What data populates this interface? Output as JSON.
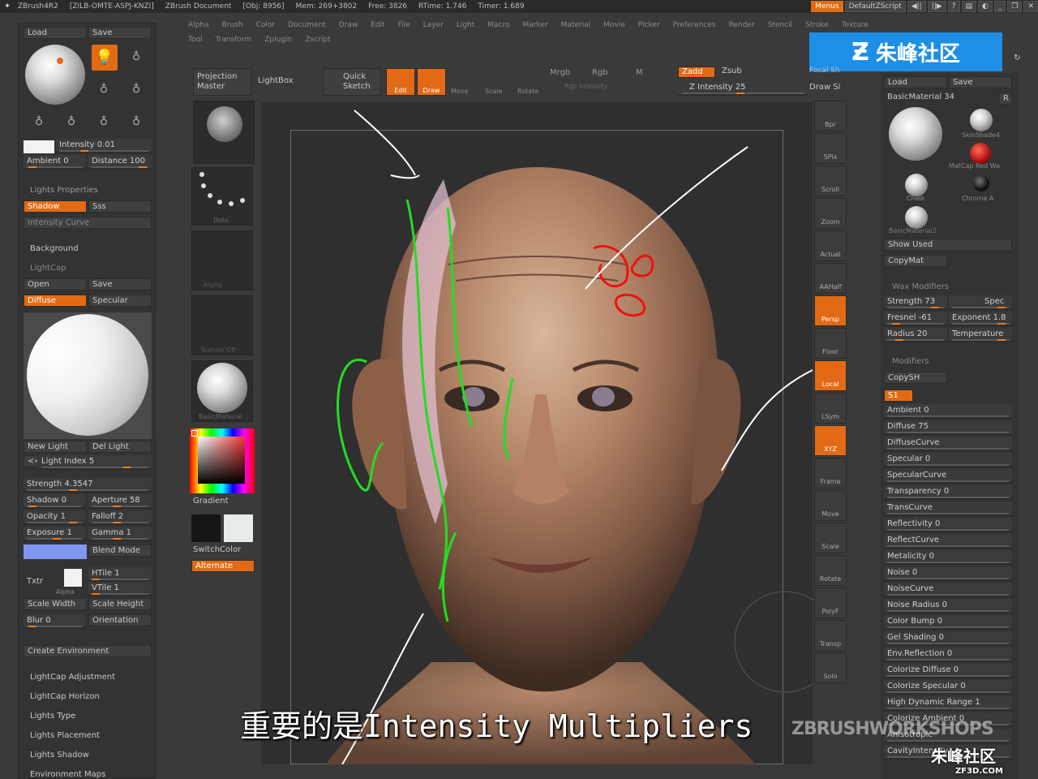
{
  "titlebar": {
    "app": "ZBrush4R2",
    "license": "[ZILB-OMTE-ASPJ-KNZI]",
    "doc": "ZBrush Document",
    "obj": "[Obj: 8956]",
    "mem": "Mem: 269+3802",
    "free": "Free: 3826",
    "rtime": "RTime: 1.746",
    "timer": "Timer: 1.689",
    "menus_btn": "Menus",
    "script_btn": "DefaultZScript"
  },
  "menubar": {
    "row1": [
      "Alpha",
      "Brush",
      "Color",
      "Document",
      "Draw",
      "Edit",
      "File",
      "Layer",
      "Light",
      "Macro",
      "Marker",
      "Material",
      "Movie",
      "Picker",
      "Preferences",
      "Render",
      "Stencil",
      "Stroke",
      "Texture"
    ],
    "row2": [
      "Tool",
      "Transform",
      "Zplugin",
      "Zscript"
    ]
  },
  "watermark": {
    "brand": "朱峰社区",
    "brand_small": "ZF3D.COM",
    "bottom_text": "ZBRUSHWORKSHOPS"
  },
  "toolbar": {
    "projection_master": "Projection Master",
    "lightbox": "LightBox",
    "quick_sketch": "Quick Sketch",
    "edit": "Edit",
    "draw": "Draw",
    "move": "Move",
    "scale": "Scale",
    "rotate": "Rotate",
    "mrgb": "Mrgb",
    "rgb": "Rgb",
    "m": "M",
    "rgb_intensity": "Rgb Intensity",
    "zadd": "Zadd",
    "zsub": "Zsub",
    "z_intensity": "Z Intensity 25",
    "focal": "Focal Sh",
    "draw_size": "Draw Si"
  },
  "left_panel": {
    "load": "Load",
    "save": "Save",
    "intensity": "Intensity 0.01",
    "ambient": "Ambient 0",
    "distance": "Distance 100",
    "lights_properties": "Lights Properties",
    "shadow": "Shadow",
    "sss": "Sss",
    "intensity_curve": "Intensity Curve",
    "background": "Background",
    "lightcap": "LightCap",
    "open": "Open",
    "save2": "Save",
    "diffuse": "Diffuse",
    "specular": "Specular",
    "new_light": "New Light",
    "del_light": "Del Light",
    "light_index": "Light Index 5",
    "strength": "Strength 4.3547",
    "shadow_val": "Shadow 0",
    "aperture": "Aperture 58",
    "opacity": "Opacity 1",
    "falloff": "Falloff 2",
    "exposure": "Exposure 1",
    "gamma": "Gamma 1",
    "blend_mode": "Blend Mode",
    "txtr": "Txtr",
    "alpha": "Alpha",
    "htile": "HTile 1",
    "vtile": "VTile 1",
    "scale_width": "Scale Width",
    "scale_height": "Scale Height",
    "blur": "Blur 0",
    "orientation": "Orientation",
    "create_env": "Create Environment",
    "lightcap_adj": "LightCap Adjustment",
    "lightcap_horizon": "LightCap Horizon",
    "lights_type": "Lights Type",
    "lights_placement": "Lights Placement",
    "lights_shadow": "Lights Shadow",
    "env_maps": "Environment Maps"
  },
  "palette": {
    "alpha_label": "Alpha",
    "stroke_label": "Dots",
    "texture_label": "Texture Off",
    "material_label": "BasicMaterial",
    "gradient": "Gradient",
    "switch_color": "SwitchColor",
    "alternate": "Alternate"
  },
  "right_tools": [
    "Bpr",
    "SPix",
    "Scroll",
    "Zoom",
    "Actual",
    "AAHalf",
    "Persp",
    "Floor",
    "Local",
    "LSym",
    "XYZ",
    "Frame",
    "Move",
    "Scale",
    "Rotate",
    "PolyF",
    "Transp",
    "Solo"
  ],
  "right_panel": {
    "load": "Load",
    "save": "Save",
    "material": "BasicMaterial 34",
    "r": "R",
    "skinshade": "SkinShade4",
    "matcap_red": "MatCap Red Wa",
    "chalk": "Chalk",
    "chrome": "Chrome A",
    "basicmat2": "BasicMaterial2",
    "show_used": "Show Used",
    "copymat": "CopyMat",
    "wax_modifiers": "Wax Modifiers",
    "strength": "Strength 73",
    "spec": "Spec",
    "fresnel": "Fresnel -61",
    "exponent": "Exponent 1.8",
    "radius": "Radius 20",
    "temperature": "Temperature",
    "modifiers": "Modifiers",
    "copysh": "CopySH",
    "s1": "S1",
    "ambient": "Ambient 0",
    "diffuse": "Diffuse 75",
    "diffuse_curve": "DiffuseCurve",
    "specular": "Specular 0",
    "specular_curve": "SpecularCurve",
    "transparency": "Transparency 0",
    "trans_curve": "TransCurve",
    "reflectivity": "Reflectivity 0",
    "reflect_curve": "ReflectCurve",
    "metalicity": "Metalicity 0",
    "noise": "Noise 0",
    "noise_curve": "NoiseCurve",
    "noise_radius": "Noise Radius 0",
    "color_bump": "Color Bump 0",
    "gel_shading": "Gel Shading 0",
    "env_reflection": "Env.Reflection 0",
    "colorize_diffuse": "Colorize Diffuse 0",
    "colorize_specular": "Colorize Specular 0",
    "high_dynamic": "High Dynamic Range 1",
    "colorize_ambient": "Colorize Ambient 0",
    "anisotropic": "Anisotropic",
    "cavity": "CavityIntensity"
  },
  "subtitle": "重要的是Intensity Multipliers",
  "colors": {
    "accent": "#e36a14",
    "panel": "#333333",
    "bg": "#3a3a3a",
    "annotation_green": "#22dd22",
    "annotation_red": "#ee1111"
  }
}
